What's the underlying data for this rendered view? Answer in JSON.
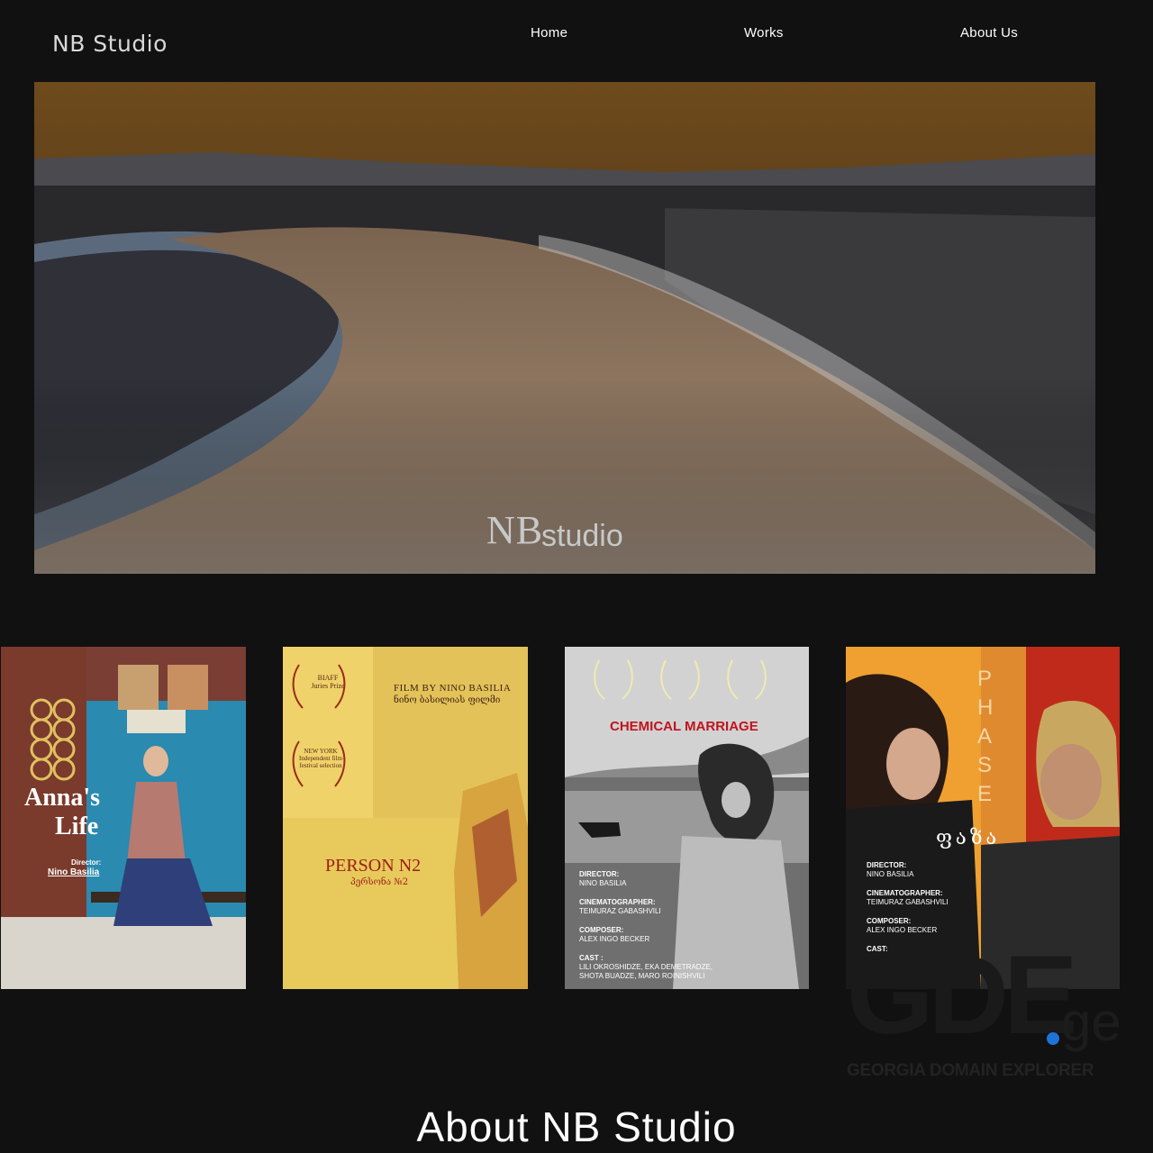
{
  "header": {
    "logo": "NB Studio",
    "nav": {
      "home": "Home",
      "works": "Works",
      "about": "About Us"
    }
  },
  "hero": {
    "watermark_nb": "NB",
    "watermark_studio": "studio"
  },
  "posters": {
    "annas_life": {
      "title_line1": "Anna's",
      "title_line2": "Life",
      "director_label": "Director:",
      "director": "Nino Basilia"
    },
    "person_n2": {
      "title": "PERSON N2",
      "title_ka": "პერსონა №2",
      "film_by": "FILM BY NINO BASILIA",
      "film_by_ka": "ნინო ბასილიას ფილმი",
      "laurel1": "BIAFF Juries Prize",
      "laurel2": "NEW YORK Independent film festival selection"
    },
    "chemical_marriage": {
      "title": "CHEMICAL MARRIAGE",
      "director_label": "DIRECTOR:",
      "director": "NINO BASILIA",
      "cinematographer_label": "CINEMATOGRAPHER:",
      "cinematographer": "TEIMURAZ GABASHVILI",
      "composer_label": "COMPOSER:",
      "composer": "ALEX INGO BECKER",
      "cast_label": "CAST :",
      "cast_line1": "LILI OKROSHIDZE,  EKA DEMETRADZE,",
      "cast_line2": "SHOTA BUADZE, MARO ROINISHVILI"
    },
    "phase": {
      "title_letters": [
        "P",
        "H",
        "A",
        "S",
        "E"
      ],
      "title_ka": "ფაზა",
      "director_label": "DIRECTOR:",
      "director": "NINO BASILIA",
      "cinematographer_label": "CINEMATOGRAPHER:",
      "cinematographer": "TEIMURAZ GABASHVILI",
      "composer_label": "COMPOSER:",
      "composer": "ALEX INGO BECKER",
      "cast_label": "CAST:"
    }
  },
  "watermark": {
    "big": "GDE",
    "ge": "ge",
    "sub": "GEORGIA DOMAIN EXPLORER"
  },
  "about": {
    "title": "About NB Studio"
  }
}
